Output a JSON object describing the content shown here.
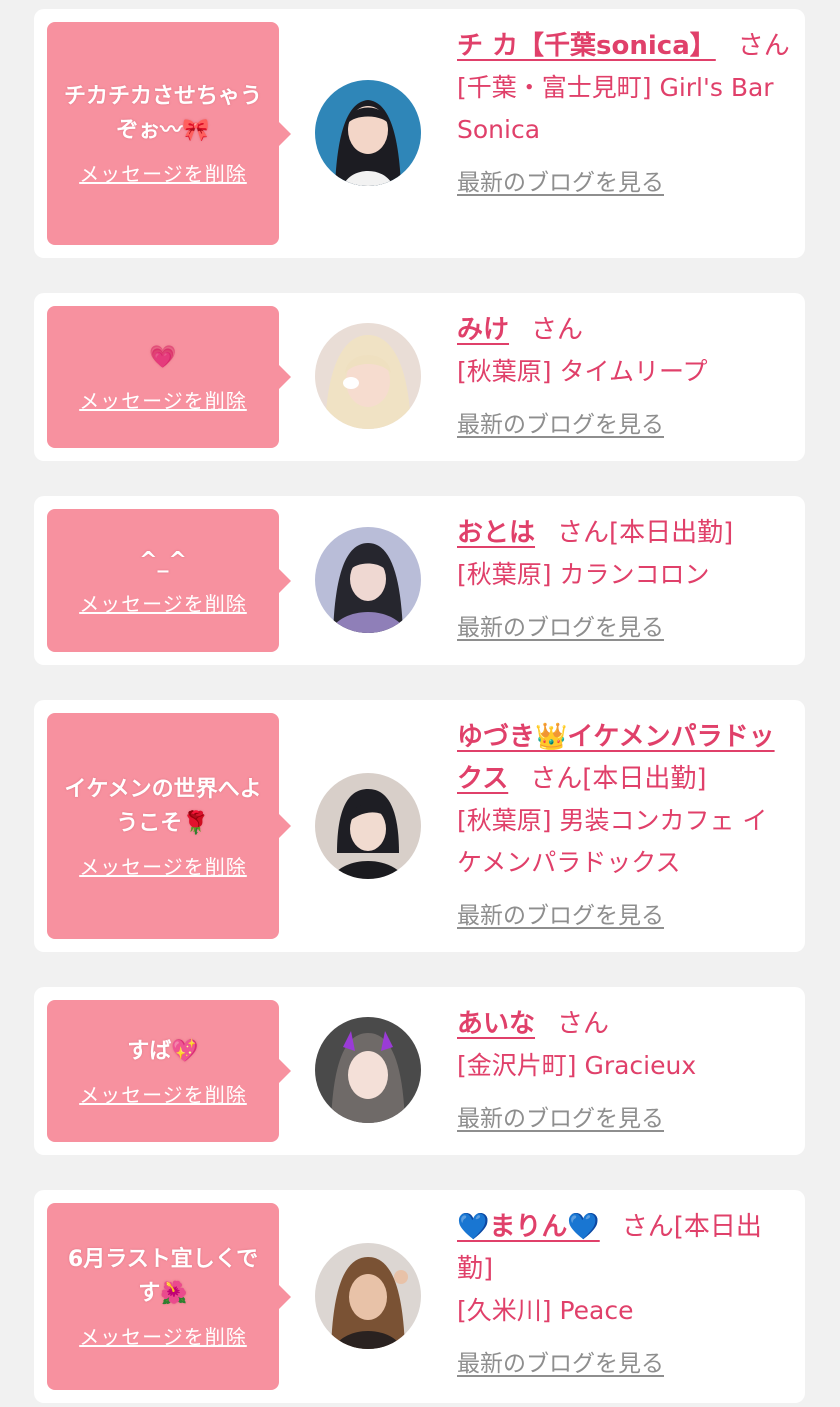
{
  "theme": {
    "bubble": "#f7919f",
    "accent": "#e0406a",
    "link_gray": "#8e8e8e",
    "background": "#f1f1f1",
    "card": "#ffffff"
  },
  "delete_label": "メッセージを削除",
  "blog_label": "最新のブログを見る",
  "san_label": "さん",
  "entries": [
    {
      "message": "チカチカさせちゃうぞぉ〰🎀",
      "name": "チ カ【千葉sonica】",
      "status": "",
      "shop": "[千葉・富士見町] Girl's Bar Sonica",
      "avatar_icon": "avatar-girl-dark-hair"
    },
    {
      "message": "💗",
      "name": "みけ",
      "status": "",
      "shop": "[秋葉原] タイムリープ",
      "avatar_icon": "avatar-girl-blonde"
    },
    {
      "message": "^_^",
      "name": "おとは",
      "status": "[本日出勤]",
      "shop": "[秋葉原] カランコロン",
      "avatar_icon": "avatar-girl-purple"
    },
    {
      "message": "イケメンの世界へようこそ🌹",
      "name": "ゆづき👑イケメンパラドックス",
      "status": "[本日出勤]",
      "shop": "[秋葉原] 男装コンカフェ イケメンパラドックス",
      "avatar_icon": "avatar-short-hair"
    },
    {
      "message": "すば💖",
      "name": "あいな",
      "status": "",
      "shop": "[金沢片町] Gracieux",
      "avatar_icon": "avatar-girl-devil-horns"
    },
    {
      "message": "6月ラスト宜しくです🌺",
      "name": "💙まりん💙",
      "status": "[本日出勤]",
      "shop": "[久米川] Peace",
      "avatar_icon": "avatar-girl-brown-hair"
    }
  ]
}
